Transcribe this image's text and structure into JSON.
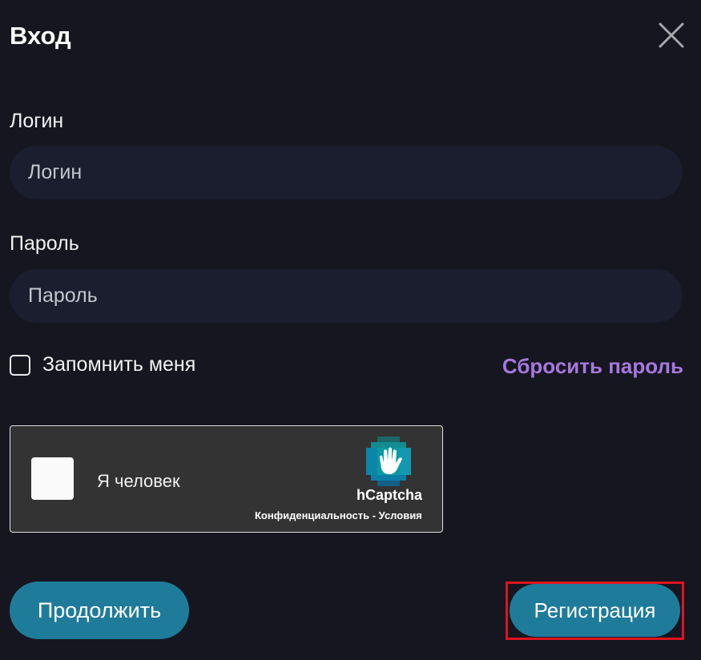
{
  "dialog": {
    "title": "Вход",
    "close_icon": "close-icon"
  },
  "login": {
    "label": "Логин",
    "placeholder": "Логин",
    "value": ""
  },
  "password": {
    "label": "Пароль",
    "placeholder": "Пароль",
    "value": ""
  },
  "remember": {
    "label": "Запомнить меня",
    "checked": false
  },
  "reset_link": "Сбросить пароль",
  "captcha": {
    "label": "Я человек",
    "brand": "hCaptcha",
    "privacy": "Конфиденциальность",
    "separator": " - ",
    "terms": "Условия",
    "logo_icon": "hcaptcha-hand-icon"
  },
  "buttons": {
    "continue": "Продолжить",
    "register": "Регистрация"
  },
  "colors": {
    "background": "#15161f",
    "input_bg": "#1a1e2e",
    "accent_link": "#a778de",
    "button": "#1f7b9a",
    "highlight": "#e0141e"
  }
}
